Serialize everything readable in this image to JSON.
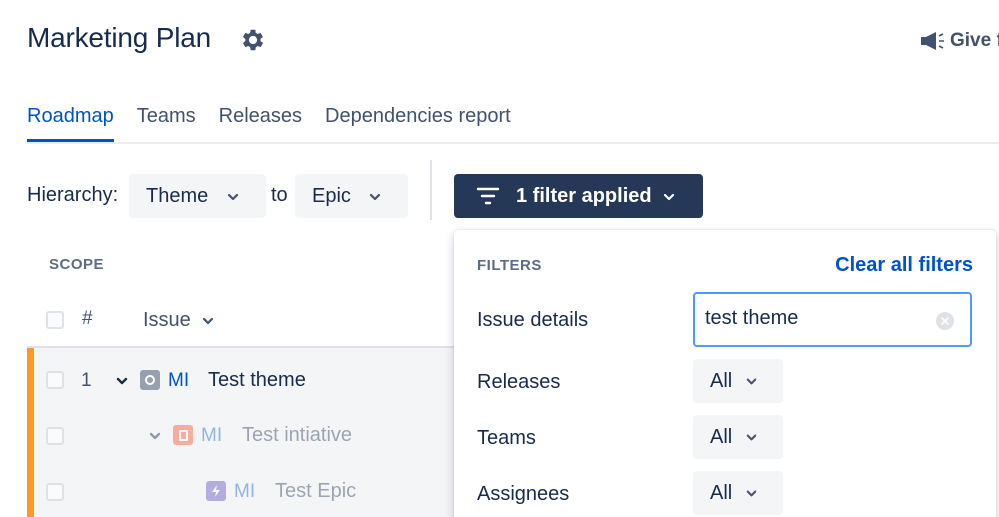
{
  "header": {
    "title": "Marketing Plan",
    "feedback_label": "Give f"
  },
  "tabs": [
    {
      "label": "Roadmap",
      "active": true
    },
    {
      "label": "Teams",
      "active": false
    },
    {
      "label": "Releases",
      "active": false
    },
    {
      "label": "Dependencies report",
      "active": false
    }
  ],
  "toolbar": {
    "hierarchy_label": "Hierarchy:",
    "hierarchy_from": "Theme",
    "to_label": "to",
    "hierarchy_to": "Epic",
    "filter_button_label": "1 filter applied"
  },
  "scope": {
    "heading": "SCOPE",
    "column_hash": "#",
    "column_issue": "Issue",
    "rows": [
      {
        "number": "1",
        "key": "MI",
        "name": "Test theme",
        "type_icon": "theme-icon",
        "color": "#97a0af"
      },
      {
        "number": "",
        "key": "MI",
        "name": "Test intiative",
        "type_icon": "initiative-icon",
        "color": "#ff5630"
      },
      {
        "number": "",
        "key": "MI",
        "name": "Test Epic",
        "type_icon": "epic-icon",
        "color": "#6554c0"
      }
    ]
  },
  "filters_panel": {
    "title": "FILTERS",
    "clear_all_label": "Clear all filters",
    "issue_details_label": "Issue details",
    "issue_details_value": "test theme",
    "releases_label": "Releases",
    "releases_value": "All",
    "teams_label": "Teams",
    "teams_value": "All",
    "assignees_label": "Assignees",
    "assignees_value": "All"
  },
  "colors": {
    "accent_blue": "#0052cc",
    "filter_button_bg": "#253858",
    "row_accent": "#ff991f",
    "input_focus": "#4c9aff"
  }
}
